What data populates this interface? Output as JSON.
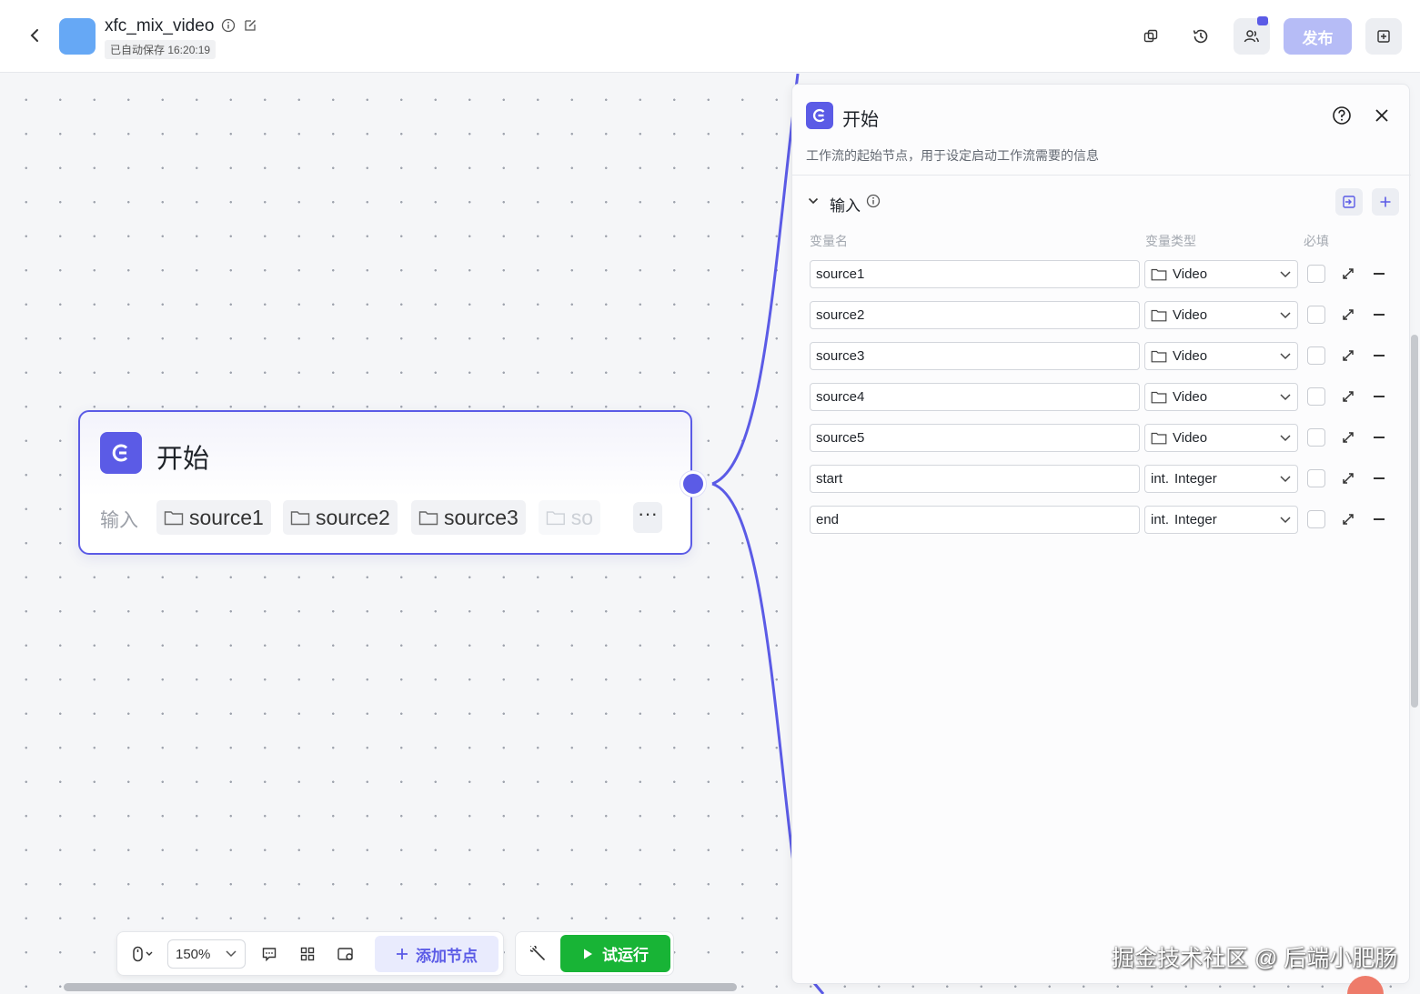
{
  "header": {
    "back_icon": "chevron-left-icon",
    "app_name": "xfc_mix_video",
    "autosave_text": "已自动保存 16:20:19",
    "publish_label": "发布",
    "accent_color": "#5b5be6"
  },
  "node": {
    "title": "开始",
    "input_label": "输入",
    "chips": [
      "source1",
      "source2",
      "source3",
      "so"
    ],
    "more_label": "···"
  },
  "toolbar": {
    "zoom": "150%",
    "add_node_label": "添加节点",
    "run_label": "试运行",
    "run_color": "#18b436"
  },
  "panel": {
    "title": "开始",
    "description": "工作流的起始节点，用于设定启动工作流需要的信息",
    "section_title": "输入",
    "col_name": "变量名",
    "col_type": "变量类型",
    "col_required": "必填",
    "rows": [
      {
        "name": "source1",
        "type": "Video",
        "type_icon": "folder-icon",
        "required": false
      },
      {
        "name": "source2",
        "type": "Video",
        "type_icon": "folder-icon",
        "required": false
      },
      {
        "name": "source3",
        "type": "Video",
        "type_icon": "folder-icon",
        "required": false
      },
      {
        "name": "source4",
        "type": "Video",
        "type_icon": "folder-icon",
        "required": false
      },
      {
        "name": "source5",
        "type": "Video",
        "type_icon": "folder-icon",
        "required": false
      },
      {
        "name": "start",
        "type": "Integer",
        "type_prefix": "int.",
        "required": false
      },
      {
        "name": "end",
        "type": "Integer",
        "type_prefix": "int.",
        "required": false
      }
    ]
  },
  "watermark": "掘金技术社区 @ 后端小肥肠"
}
